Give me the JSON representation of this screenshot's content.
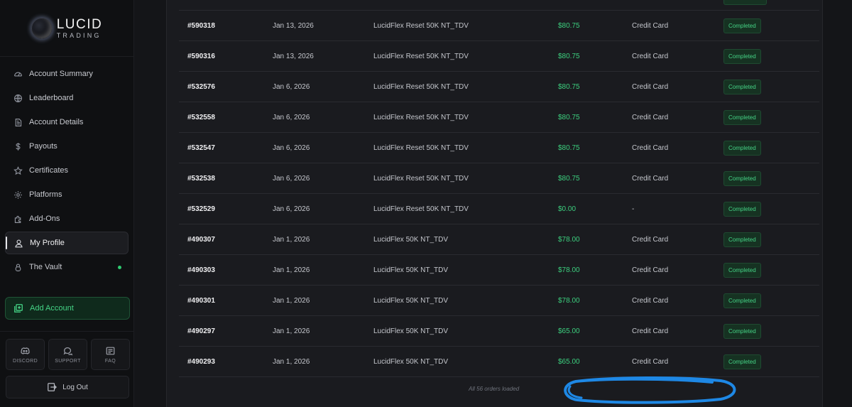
{
  "brand": {
    "name": "LUCID",
    "sub": "TRADING"
  },
  "sidebar": {
    "items": [
      {
        "label": "Account Summary",
        "icon": "gauge-icon"
      },
      {
        "label": "Leaderboard",
        "icon": "globe-icon"
      },
      {
        "label": "Account Details",
        "icon": "document-icon"
      },
      {
        "label": "Payouts",
        "icon": "dollar-icon"
      },
      {
        "label": "Certificates",
        "icon": "star-icon"
      },
      {
        "label": "Platforms",
        "icon": "gear-icon"
      },
      {
        "label": "Add-Ons",
        "icon": "puzzle-icon"
      },
      {
        "label": "My Profile",
        "icon": "user-icon",
        "active": true
      },
      {
        "label": "The Vault",
        "icon": "lock-icon",
        "indicator": "online"
      }
    ],
    "add_account": "Add Account",
    "quick": [
      {
        "label": "DISCORD",
        "icon": "discord-icon"
      },
      {
        "label": "SUPPORT",
        "icon": "chat-icon"
      },
      {
        "label": "FAQ",
        "icon": "faq-icon"
      }
    ],
    "logout": "Log Out"
  },
  "orders": {
    "rows": [
      {
        "id": "#590318",
        "date": "Jan 13, 2026",
        "item": "LucidFlex Reset 50K NT_TDV",
        "amount": "$80.75",
        "payment": "Credit Card",
        "status": "Completed"
      },
      {
        "id": "#590316",
        "date": "Jan 13, 2026",
        "item": "LucidFlex Reset 50K NT_TDV",
        "amount": "$80.75",
        "payment": "Credit Card",
        "status": "Completed"
      },
      {
        "id": "#532576",
        "date": "Jan 6, 2026",
        "item": "LucidFlex Reset 50K NT_TDV",
        "amount": "$80.75",
        "payment": "Credit Card",
        "status": "Completed"
      },
      {
        "id": "#532558",
        "date": "Jan 6, 2026",
        "item": "LucidFlex Reset 50K NT_TDV",
        "amount": "$80.75",
        "payment": "Credit Card",
        "status": "Completed"
      },
      {
        "id": "#532547",
        "date": "Jan 6, 2026",
        "item": "LucidFlex Reset 50K NT_TDV",
        "amount": "$80.75",
        "payment": "Credit Card",
        "status": "Completed"
      },
      {
        "id": "#532538",
        "date": "Jan 6, 2026",
        "item": "LucidFlex Reset 50K NT_TDV",
        "amount": "$80.75",
        "payment": "Credit Card",
        "status": "Completed"
      },
      {
        "id": "#532529",
        "date": "Jan 6, 2026",
        "item": "LucidFlex Reset 50K NT_TDV",
        "amount": "$0.00",
        "payment": "-",
        "status": "Completed"
      },
      {
        "id": "#490307",
        "date": "Jan 1, 2026",
        "item": "LucidFlex 50K NT_TDV",
        "amount": "$78.00",
        "payment": "Credit Card",
        "status": "Completed"
      },
      {
        "id": "#490303",
        "date": "Jan 1, 2026",
        "item": "LucidFlex 50K NT_TDV",
        "amount": "$78.00",
        "payment": "Credit Card",
        "status": "Completed"
      },
      {
        "id": "#490301",
        "date": "Jan 1, 2026",
        "item": "LucidFlex 50K NT_TDV",
        "amount": "$78.00",
        "payment": "Credit Card",
        "status": "Completed"
      },
      {
        "id": "#490297",
        "date": "Jan 1, 2026",
        "item": "LucidFlex 50K NT_TDV",
        "amount": "$65.00",
        "payment": "Credit Card",
        "status": "Completed"
      },
      {
        "id": "#490293",
        "date": "Jan 1, 2026",
        "item": "LucidFlex 50K NT_TDV",
        "amount": "$65.00",
        "payment": "Credit Card",
        "status": "Completed"
      }
    ],
    "loaded_text": "All 56 orders loaded"
  },
  "colors": {
    "accent_green": "#45d486",
    "amount_green": "#3ccf7e",
    "annotation_blue": "#1e88e5"
  }
}
